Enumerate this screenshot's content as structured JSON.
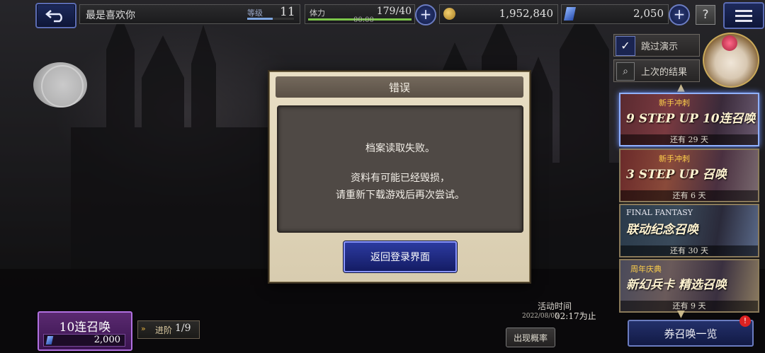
{
  "topbar": {
    "player_name": "最是喜欢你",
    "level_label": "等级",
    "level_value": "11",
    "stamina_label": "体力",
    "stamina_value": "179/40",
    "stamina_timer": "00:00",
    "gil_value": "1,952,840",
    "lapis_value": "2,050",
    "help_label": "?"
  },
  "side": {
    "skip_label": "跳过演示",
    "prev_result_label": "上次的结果",
    "banners": [
      {
        "tag": "新手冲刺",
        "title": "9 STEP UP 10连召唤",
        "remain": "还有 29 天"
      },
      {
        "tag": "新手冲刺",
        "title": "3 STEP UP 召唤",
        "remain": "还有 6 天"
      },
      {
        "tag": "FINAL FANTASY",
        "title": "联动纪念召唤",
        "remain": "还有 30 天"
      },
      {
        "tag": "周年庆典",
        "title": "新幻兵卡 精选召唤",
        "remain": "还有 9 天"
      }
    ],
    "voucher_label": "券召唤一览",
    "voucher_badge": "!"
  },
  "bottom": {
    "summon_label": "10连召唤",
    "summon_cost": "2,000",
    "step_label": "进阶",
    "step_value": "1/9",
    "event_label": "活动时间",
    "event_date": "2022/08/05",
    "event_end": "02:17为止",
    "rate_label": "出现概率"
  },
  "dialog": {
    "title": "错误",
    "line1": "档案读取失败。",
    "line2": "资料有可能已经毁损，",
    "line3": "请重新下载游戏后再次尝试。",
    "button_label": "返回登录界面"
  },
  "progress": {
    "level_fraction": 0.55,
    "stamina_fraction": 1.0
  },
  "icons": [
    "back-arrow-icon",
    "plus-icon",
    "gil-coin-icon",
    "lapis-crystal-icon",
    "help-icon",
    "hamburger-menu-icon",
    "checkmark-icon",
    "magnifier-icon",
    "moogle-icon"
  ]
}
